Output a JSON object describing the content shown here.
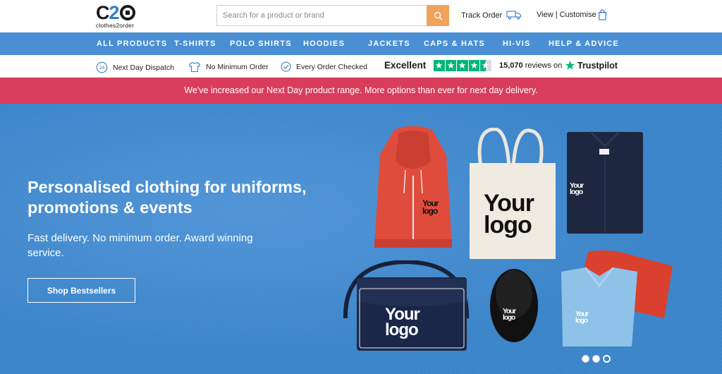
{
  "header": {
    "logo": {
      "mark_prefix": "C",
      "mark_suffix": "2",
      "subtitle": "clothes2order"
    },
    "search": {
      "placeholder": "Search for a product or brand",
      "icon": "search-icon"
    },
    "track_order_label": "Track Order",
    "view_customise_label": "View | Customise",
    "icons": {
      "track": "truck-icon",
      "bag": "shopping-bag-icon"
    }
  },
  "nav": {
    "items": [
      {
        "label": "ALL PRODUCTS"
      },
      {
        "label": "T-SHIRTS"
      },
      {
        "label": "POLO SHIRTS"
      },
      {
        "label": "HOODIES"
      },
      {
        "label": "JACKETS"
      },
      {
        "label": "CAPS & HATS"
      },
      {
        "label": "HI-VIS"
      },
      {
        "label": "HELP & ADVICE"
      }
    ],
    "background": "#4a8fd4"
  },
  "usp": {
    "items": [
      {
        "label": "Next Day Dispatch",
        "icon": "24-hour-icon",
        "icon_text": "24"
      },
      {
        "label": "No Minimum Order",
        "icon": "tshirt-icon"
      },
      {
        "label": "Every Order Checked",
        "icon": "check-circle-icon"
      }
    ],
    "trustpilot": {
      "rating_text": "Excellent",
      "stars": 4.5,
      "review_count": "15,070",
      "reviews_on": "reviews on",
      "brand": "Trustpilot",
      "star_color": "#00b67a"
    }
  },
  "promo": {
    "text": "We've increased our Next Day product range. More options than ever for next day delivery.",
    "background": "#d93d5c"
  },
  "hero": {
    "title": "Personalised clothing for uniforms, promotions & events",
    "subtitle": "Fast delivery. No minimum order. Award winning service.",
    "cta_label": "Shop Bestsellers",
    "background": "#3c86cc",
    "product_logo_line1": "Your",
    "product_logo_line2": "logo",
    "carousel": {
      "count": 3,
      "active": 3
    }
  }
}
